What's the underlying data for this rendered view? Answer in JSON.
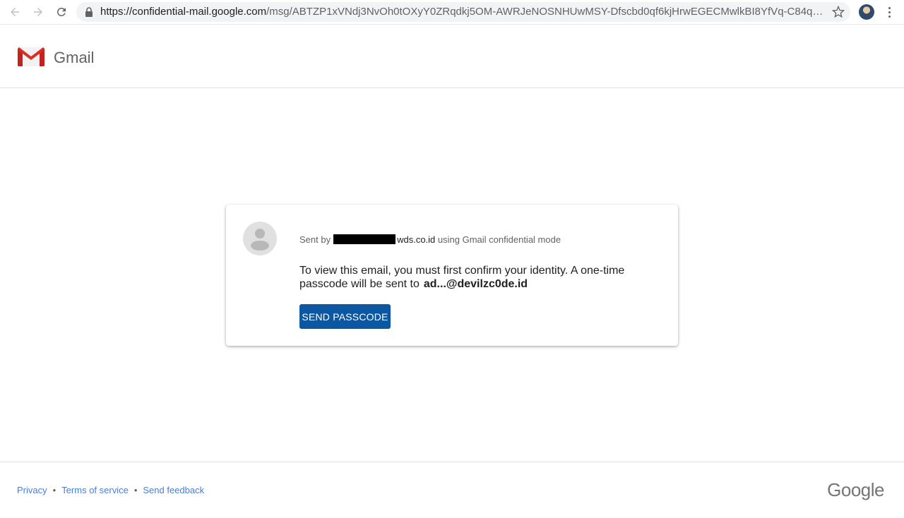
{
  "browser": {
    "url_host": "https://confidential-mail.google.com",
    "url_path": "/msg/ABTZP1xVNdj3NvOh0tOXyY0ZRqdkj5OM-AWRJeNOSNHUwMSY-Dfscbd0qf6kjHrwEGECMwlkBI8YfVq-C84qJi..."
  },
  "header": {
    "app_name": "Gmail"
  },
  "card": {
    "sent_prefix": "Sent by",
    "sent_domain": "wds.co.id",
    "sent_suffix": "using Gmail confidential mode",
    "message": "To view this email, you must first confirm your identity. A one-time passcode will be sent to",
    "email": "ad...@devilzc0de.id",
    "button_label": "SEND PASSCODE"
  },
  "footer": {
    "links": [
      "Privacy",
      "Terms of service",
      "Send feedback"
    ],
    "separator": "•",
    "brand": "Google"
  },
  "colors": {
    "button": "#0b57a2",
    "link": "#4a7fd4"
  }
}
